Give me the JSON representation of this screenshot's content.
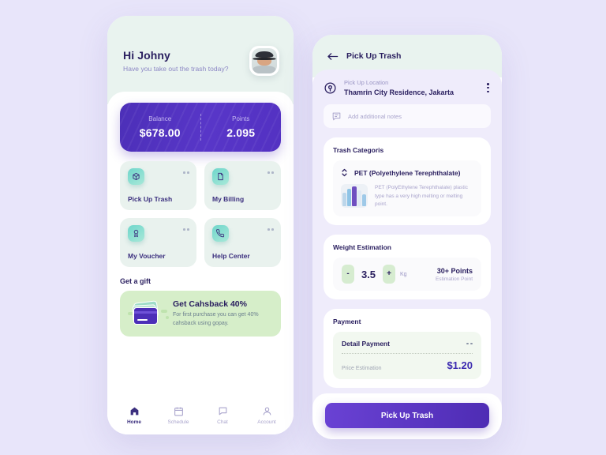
{
  "home": {
    "greeting": "Hi Johny",
    "subtitle": "Have you take out the trash today?",
    "avatar_icon": "user-avatar",
    "balance": {
      "balance_label": "Balance",
      "balance_value": "$678.00",
      "points_label": "Points",
      "points_value": "2.095"
    },
    "menu": [
      {
        "label": "Pick Up Trash",
        "icon": "box-icon"
      },
      {
        "label": "My Billing",
        "icon": "document-icon"
      },
      {
        "label": "My Voucher",
        "icon": "award-icon"
      },
      {
        "label": "Help Center",
        "icon": "phone-icon"
      }
    ],
    "gift_section_title": "Get a gift",
    "gift": {
      "title": "Get Cahsback 40%",
      "description": "For first purchase you can get 40% cahsback using gopay.",
      "icon": "credit-cards-icon"
    },
    "nav": [
      {
        "label": "Home",
        "icon": "home-icon",
        "active": true
      },
      {
        "label": "Schedule",
        "icon": "calendar-icon",
        "active": false
      },
      {
        "label": "Chat",
        "icon": "chat-icon",
        "active": false
      },
      {
        "label": "Account",
        "icon": "person-icon",
        "active": false
      }
    ]
  },
  "detail": {
    "back_icon": "arrow-left-icon",
    "title": "Pick Up Trash",
    "location": {
      "pin_icon": "location-pin-icon",
      "label": "Pick Up Location",
      "value": "Thamrin City Residence, Jakarta",
      "menu_icon": "kebab-menu-icon"
    },
    "notes": {
      "icon": "note-icon",
      "placeholder": "Add additional notes"
    },
    "category": {
      "section_title": "Trash Categoris",
      "selector_icon": "updown-chevron-icon",
      "name": "PET (Polyethylene Terephthalate)",
      "thumb_icon": "plastic-bottles-icon",
      "description": "PET (PolyEthylene Terephthalate) plastic type has a very high melting or melting point."
    },
    "weight": {
      "section_title": "Weight Estimation",
      "decrement": "-",
      "value": "3.5",
      "increment": "+",
      "unit": "Kg",
      "points": "30+ Points",
      "points_sub": "Estimation Point"
    },
    "payment": {
      "section_title": "Payment",
      "detail_label": "Detail Payment",
      "more_icon": "more-dots-icon",
      "price_label": "Price Estimation",
      "price_value": "$1.20"
    },
    "cta_label": "Pick Up Trash"
  },
  "colors": {
    "background": "#e8e5fa",
    "primary_purple": "#4c2fb8",
    "mint_header": "#e9f3ef",
    "teal_icon": "#6fd6cb",
    "gift_green": "#d6eec9",
    "navy_text": "#2b2060"
  }
}
